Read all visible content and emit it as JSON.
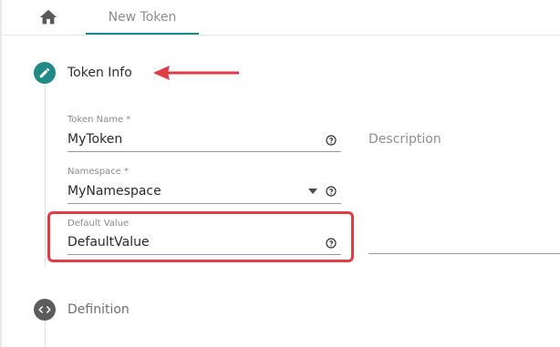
{
  "tabs": {
    "new_token": "New Token"
  },
  "steps": {
    "token_info": "Token Info",
    "definition": "Definition"
  },
  "form": {
    "token_name": {
      "label": "Token Name *",
      "value": "MyToken"
    },
    "namespace": {
      "label": "Namespace *",
      "value": "MyNamespace"
    },
    "default_value": {
      "label": "Default Value",
      "value": "DefaultValue"
    },
    "description": {
      "placeholder": "Description"
    }
  },
  "colors": {
    "accent": "#1f8a86",
    "annotation": "#e03c44",
    "step_inactive": "#5c5c5c"
  },
  "icons": {
    "home": "home-icon",
    "edit": "pencil-icon",
    "code": "code-icon",
    "help": "help-circle-icon",
    "caret": "caret-down-icon"
  }
}
